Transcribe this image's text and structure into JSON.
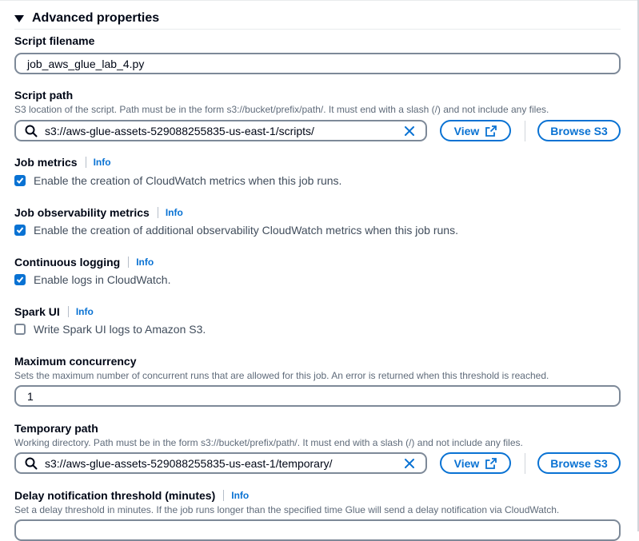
{
  "section": {
    "title": "Advanced properties"
  },
  "script_filename": {
    "label": "Script filename",
    "value": "job_aws_glue_lab_4.py"
  },
  "script_path": {
    "label": "Script path",
    "description": "S3 location of the script. Path must be in the form s3://bucket/prefix/path/. It must end with a slash (/) and not include any files.",
    "value": "s3://aws-glue-assets-529088255835-us-east-1/scripts/",
    "view_label": "View",
    "browse_label": "Browse S3"
  },
  "job_metrics": {
    "label": "Job metrics",
    "info": "Info",
    "checkbox_label": "Enable the creation of CloudWatch metrics when this job runs.",
    "checked": true
  },
  "job_observability": {
    "label": "Job observability metrics",
    "info": "Info",
    "checkbox_label": "Enable the creation of additional observability CloudWatch metrics when this job runs.",
    "checked": true
  },
  "continuous_logging": {
    "label": "Continuous logging",
    "info": "Info",
    "checkbox_label": "Enable logs in CloudWatch.",
    "checked": true
  },
  "spark_ui": {
    "label": "Spark UI",
    "info": "Info",
    "checkbox_label": "Write Spark UI logs to Amazon S3.",
    "checked": false
  },
  "max_concurrency": {
    "label": "Maximum concurrency",
    "description": "Sets the maximum number of concurrent runs that are allowed for this job. An error is returned when this threshold is reached.",
    "value": "1"
  },
  "temporary_path": {
    "label": "Temporary path",
    "description": "Working directory. Path must be in the form s3://bucket/prefix/path/. It must end with a slash (/) and not include any files.",
    "value": "s3://aws-glue-assets-529088255835-us-east-1/temporary/",
    "view_label": "View",
    "browse_label": "Browse S3"
  },
  "delay_notification": {
    "label": "Delay notification threshold (minutes)",
    "info": "Info",
    "description": "Set a delay threshold in minutes. If the job runs longer than the specified time Glue will send a delay notification via CloudWatch."
  },
  "colors": {
    "link": "#0972d3",
    "text": "#000716",
    "muted": "#5f6b7a",
    "border": "#7d8998"
  }
}
